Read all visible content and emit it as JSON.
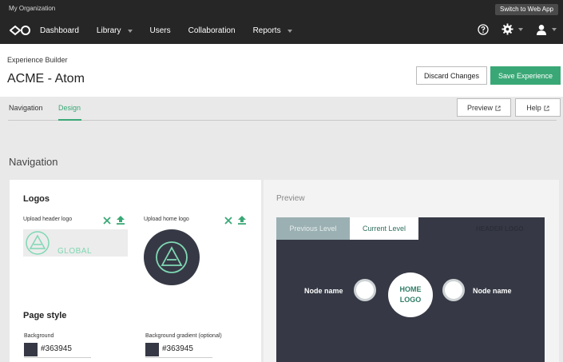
{
  "topbar": {
    "org": "My Organization",
    "switch_label": "Switch to Web App",
    "nav": [
      "Dashboard",
      "Library",
      "Users",
      "Collaboration",
      "Reports"
    ]
  },
  "header": {
    "eyebrow": "Experience Builder",
    "title": "ACME - Atom",
    "discard_label": "Discard Changes",
    "save_label": "Save Experience"
  },
  "tabs": {
    "navigation": "Navigation",
    "design": "Design",
    "preview_label": "Preview",
    "help_label": "Help"
  },
  "section": {
    "title": "Navigation"
  },
  "logos": {
    "title": "Logos",
    "header_label": "Upload header logo",
    "home_label": "Upload home logo",
    "global_text": "GLOBAL"
  },
  "page_style": {
    "title": "Page style",
    "background_label": "Background",
    "background_value": "#363945",
    "gradient_label": "Background gradient (optional)",
    "gradient_value": "#363945"
  },
  "preview": {
    "title": "Preview",
    "previous_level": "Previous Level",
    "current_level": "Current Level",
    "header_logo": "HEADER LOGO",
    "node_left": "Node name",
    "node_right": "Node name",
    "home_logo_line1": "HOME",
    "home_logo_line2": "LOGO"
  },
  "colors": {
    "accent": "#3aa876",
    "topbar": "#262626",
    "canvas": "#363945"
  }
}
